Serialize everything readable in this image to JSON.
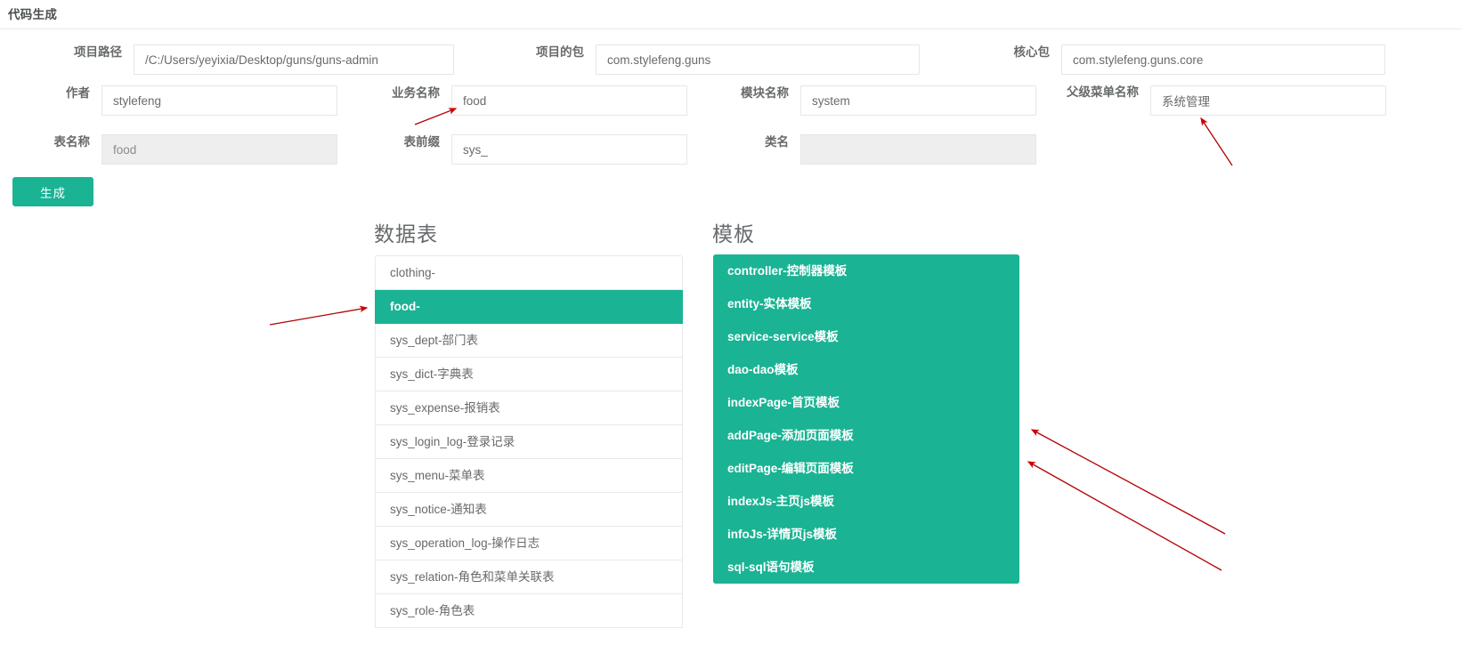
{
  "header": {
    "title": "代码生成"
  },
  "form": {
    "fields": [
      {
        "label": "项目路径",
        "value": "/C:/Users/yeyixia/Desktop/guns/guns-admin",
        "disabled": false
      },
      {
        "label": "项目的包",
        "value": "com.stylefeng.guns",
        "disabled": false
      },
      {
        "label": "核心包",
        "value": "com.stylefeng.guns.core",
        "disabled": false
      },
      {
        "label": "作者",
        "value": "stylefeng",
        "disabled": false
      },
      {
        "label": "业务名称",
        "value": "food",
        "disabled": false
      },
      {
        "label": "模块名称",
        "value": "system",
        "disabled": false
      },
      {
        "label": "父级菜单名称",
        "value": "系统管理",
        "disabled": false
      },
      {
        "label": "表名称",
        "value": "food",
        "disabled": true
      },
      {
        "label": "表前缀",
        "value": "sys_",
        "disabled": false
      },
      {
        "label": "类名",
        "value": "",
        "disabled": true
      }
    ]
  },
  "actions": {
    "generate_label": "生成"
  },
  "tables_panel": {
    "heading": "数据表",
    "items": [
      {
        "label": "clothing-",
        "selected": false
      },
      {
        "label": "food-",
        "selected": true
      },
      {
        "label": "sys_dept-部门表",
        "selected": false
      },
      {
        "label": "sys_dict-字典表",
        "selected": false
      },
      {
        "label": "sys_expense-报销表",
        "selected": false
      },
      {
        "label": "sys_login_log-登录记录",
        "selected": false
      },
      {
        "label": "sys_menu-菜单表",
        "selected": false
      },
      {
        "label": "sys_notice-通知表",
        "selected": false
      },
      {
        "label": "sys_operation_log-操作日志",
        "selected": false
      },
      {
        "label": "sys_relation-角色和菜单关联表",
        "selected": false
      },
      {
        "label": "sys_role-角色表",
        "selected": false
      }
    ]
  },
  "templates_panel": {
    "heading": "模板",
    "items": [
      {
        "label": "controller-控制器模板",
        "selected": true
      },
      {
        "label": "entity-实体模板",
        "selected": true
      },
      {
        "label": "service-service模板",
        "selected": true
      },
      {
        "label": "dao-dao模板",
        "selected": true
      },
      {
        "label": "indexPage-首页模板",
        "selected": true
      },
      {
        "label": "addPage-添加页面模板",
        "selected": true
      },
      {
        "label": "editPage-编辑页面模板",
        "selected": true
      },
      {
        "label": "indexJs-主页js模板",
        "selected": true
      },
      {
        "label": "infoJs-详情页js模板",
        "selected": true
      },
      {
        "label": "sql-sql语句模板",
        "selected": true
      }
    ]
  },
  "colors": {
    "accent": "#1ab394",
    "annotation": "#cc0000",
    "border": "#e7eaec",
    "text": "#676a6c",
    "disabled_bg": "#eeeeee"
  },
  "annotations": [
    {
      "name": "arrow-to-business-name-field",
      "points_to": "业务名称"
    },
    {
      "name": "arrow-to-parent-menu-field",
      "points_to": "父级菜单名称"
    },
    {
      "name": "arrow-to-selected-table",
      "points_to": "food-"
    },
    {
      "name": "arrow-to-templates-upper",
      "points_to": "模板"
    },
    {
      "name": "arrow-to-templates-lower",
      "points_to": "模板"
    }
  ]
}
